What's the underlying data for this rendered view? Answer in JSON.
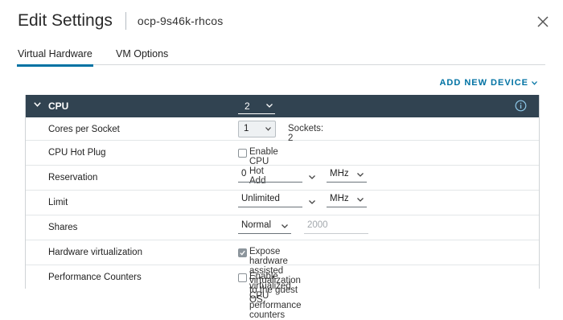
{
  "dialog": {
    "title": "Edit Settings",
    "subtitle": "ocp-9s46k-rhcos"
  },
  "tabs": [
    {
      "label": "Virtual Hardware",
      "active": true
    },
    {
      "label": "VM Options",
      "active": false
    }
  ],
  "add_device_label": "ADD NEW DEVICE",
  "cpu_section": {
    "label": "CPU",
    "value": "2"
  },
  "rows": {
    "cores_per_socket": {
      "label": "Cores per Socket",
      "value": "1",
      "sockets_text": "Sockets: 2"
    },
    "cpu_hot_plug": {
      "label": "CPU Hot Plug",
      "checkbox_label": "Enable CPU Hot Add",
      "checked": false
    },
    "reservation": {
      "label": "Reservation",
      "value": "0",
      "unit": "MHz"
    },
    "limit": {
      "label": "Limit",
      "value": "Unlimited",
      "unit": "MHz"
    },
    "shares": {
      "label": "Shares",
      "level": "Normal",
      "amount": "2000"
    },
    "hardware_virtualization": {
      "label": "Hardware virtualization",
      "checkbox_label": "Expose hardware assisted virtualization to the guest OS",
      "checked": true
    },
    "performance_counters": {
      "label": "Performance Counters",
      "checkbox_label": "Enable virtualized CPU performance counters",
      "checked": false
    }
  },
  "colors": {
    "accent": "#0072a3",
    "section_header": "#314351",
    "checked_box": "#8c959c"
  },
  "icons": [
    "close-icon",
    "chevron-down-icon",
    "info-icon",
    "check-icon"
  ]
}
